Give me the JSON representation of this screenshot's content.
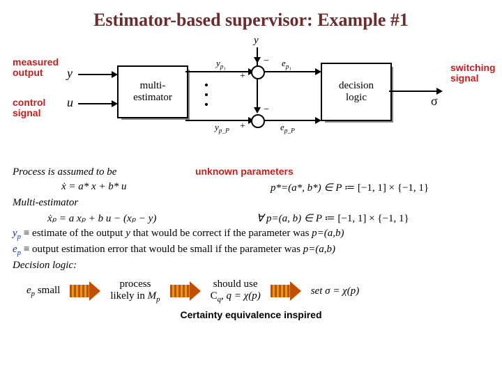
{
  "title": "Estimator-based supervisor: Example #1",
  "diagram": {
    "top_y": "y",
    "measured_output_label": "measured\noutput",
    "measured_output_sym": "y",
    "control_signal_label": "control\nsignal",
    "control_signal_sym": "u",
    "multi_estimator": "multi-\nestimator",
    "yp1": "y",
    "yp1_sub": "p₁",
    "ypP": "y",
    "ypP_sub": "p_P",
    "ep1": "e",
    "ep1_sub": "p₁",
    "epP": "e",
    "epP_sub": "p_P",
    "minus": "−",
    "plus": "+",
    "decision_logic": "decision\nlogic",
    "sigma": "σ",
    "switching_signal": "switching\nsignal"
  },
  "process_line": "Process is assumed to be",
  "process_eq_img": "ẋ = a* x + b* u",
  "unknown_params": "unknown parameters",
  "pstar_line_a": "p*=(a*, b*) ∈ ",
  "pstar_line_b": "P",
  "pstar_line_c": " ≔ [−1, 1] × {−1, 1}",
  "multi_est_heading": "Multi-estimator",
  "multi_eq_img": "ẋₚ = a xₚ + b u − (xₚ − y)",
  "forall_line_a": "∀ p=(a, b) ∈ ",
  "forall_line_b": "P",
  "forall_line_c": " ≔ [−1, 1] × {−1, 1}",
  "yp_def_a": "y",
  "yp_def_b": " ≡ estimate of the output ",
  "yp_def_c": "y",
  "yp_def_d": " that would be correct if the parameter was ",
  "yp_def_e": "p=(a,b)",
  "ep_def_a": "e",
  "ep_def_b": " ≡ output estimation error that would be small if the parameter was ",
  "ep_def_c": "p=(a,b)",
  "decision_heading": "Decision logic:",
  "logic": {
    "ep_small_a": "e",
    "ep_small_b": " small",
    "step2a": "process",
    "step2b": "likely in ",
    "step2c": "M",
    "step3a": "should use",
    "step3b": "C",
    "step3c": ", q = χ(p)",
    "step4": "set σ = χ(p)"
  },
  "cert": "Certainty equivalence inspired"
}
